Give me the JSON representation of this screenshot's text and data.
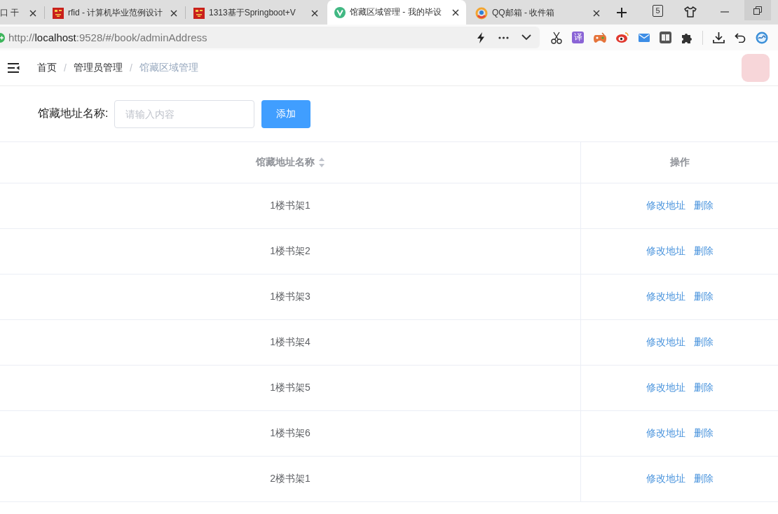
{
  "browser": {
    "tabs": [
      {
        "kind": "plain",
        "title": "口 干",
        "selected": false
      },
      {
        "kind": "square",
        "title": "rfid - 计算机毕业范例设计",
        "selected": false
      },
      {
        "kind": "square",
        "title": "1313基于Springboot+V",
        "selected": false
      },
      {
        "kind": "v",
        "title": "馆藏区域管理 - 我的毕设",
        "selected": true
      },
      {
        "kind": "ring",
        "title": "QQ邮箱 - 收件箱",
        "selected": false
      }
    ],
    "tab_count": "5"
  },
  "address_bar": {
    "url": "http://**localhost**:9528/#/book/adminAddress",
    "translate_badge": "译"
  },
  "breadcrumb": [
    {
      "label": "首页",
      "current": false
    },
    {
      "separator": "/",
      "label": "管理员管理",
      "current": false
    },
    {
      "separator": "/",
      "label": "馆藏区域管理",
      "current": true
    }
  ],
  "filter": {
    "label": "馆藏地址名称:",
    "placeholder": "请输入内容",
    "button": "添加"
  },
  "table": {
    "columns": [
      {
        "label": "馆藏地址名称",
        "sortable": true
      },
      {
        "label": "操作",
        "sortable": false
      }
    ],
    "rows": [
      {
        "name": "1楼书架1",
        "actions": [
          "修改地址",
          "删除"
        ]
      },
      {
        "name": "1楼书架2",
        "actions": [
          "修改地址",
          "删除"
        ]
      },
      {
        "name": "1楼书架3",
        "actions": [
          "修改地址",
          "删除"
        ]
      },
      {
        "name": "1楼书架4",
        "actions": [
          "修改地址",
          "删除"
        ]
      },
      {
        "name": "1楼书架5",
        "actions": [
          "修改地址",
          "删除"
        ]
      },
      {
        "name": "1楼书架6",
        "actions": [
          "修改地址",
          "删除"
        ]
      },
      {
        "name": "2楼书架1",
        "actions": [
          "修改地址",
          "删除"
        ]
      }
    ]
  }
}
